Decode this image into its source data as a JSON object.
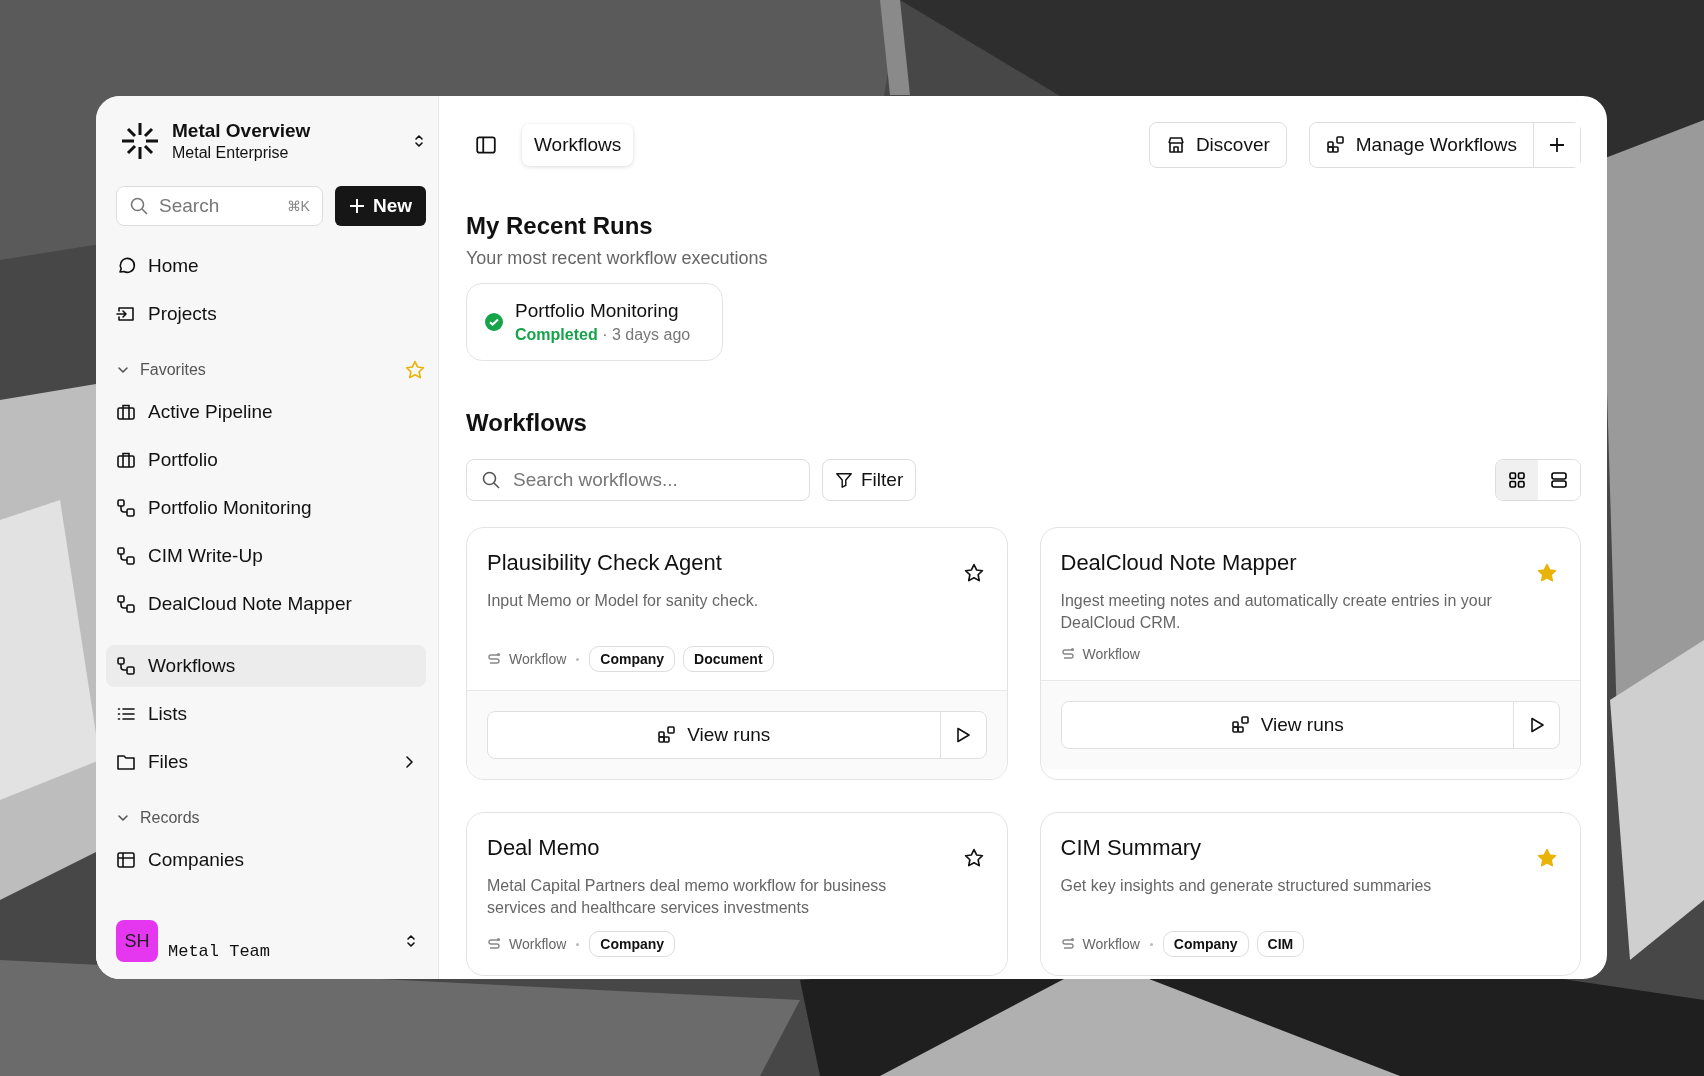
{
  "sidebar": {
    "workspace": {
      "name": "Metal Overview",
      "subtitle": "Metal Enterprise"
    },
    "search": {
      "placeholder": "Search",
      "shortcut": "⌘K"
    },
    "new_button": "New",
    "primary": [
      {
        "label": "Home",
        "kind": "chat",
        "selected": false
      },
      {
        "label": "Projects",
        "kind": "import",
        "selected": false
      }
    ],
    "favorites": {
      "label": "Favorites",
      "expanded": true,
      "items": [
        {
          "label": "Active Pipeline",
          "kind": "briefcase",
          "selected": false
        },
        {
          "label": "Portfolio",
          "kind": "briefcase",
          "selected": false
        },
        {
          "label": "Portfolio Monitoring",
          "kind": "flow",
          "selected": false
        },
        {
          "label": "CIM Write-Up",
          "kind": "flow",
          "selected": false
        },
        {
          "label": "DealCloud Note Mapper",
          "kind": "flow",
          "selected": false
        }
      ]
    },
    "secondary": [
      {
        "label": "Workflows",
        "kind": "flow",
        "selected": true,
        "expandable": false
      },
      {
        "label": "Lists",
        "kind": "list",
        "selected": false,
        "expandable": false
      },
      {
        "label": "Files",
        "kind": "folder",
        "selected": false,
        "expandable": true
      }
    ],
    "records": {
      "label": "Records",
      "expanded": true,
      "items": [
        {
          "label": "Companies",
          "kind": "table",
          "selected": false
        }
      ]
    },
    "user": {
      "initials": "SH",
      "team": "Metal Team"
    }
  },
  "main": {
    "breadcrumb": "Workflows",
    "actions": [
      {
        "label": "Discover",
        "kind": "store"
      },
      {
        "label": "Manage Workflows",
        "kind": "manage"
      }
    ],
    "recent_runs": {
      "title": "My Recent Runs",
      "subtitle": "Your most recent workflow executions",
      "runs": [
        {
          "name": "Portfolio Monitoring",
          "status": "Completed",
          "time": "· 3 days ago"
        }
      ]
    },
    "workflows": {
      "title": "Workflows",
      "search_placeholder": "Search workflows...",
      "filter": "Filter",
      "views": [
        {
          "kind": "grid",
          "selected": true
        },
        {
          "kind": "list",
          "selected": false
        }
      ],
      "cards": [
        {
          "title": "Plausibility Check Agent",
          "description": "Input Memo or Model for sanity check.",
          "type": "Workflow",
          "tags": [
            "Company",
            "Document"
          ],
          "favorite": false,
          "action": "View runs"
        },
        {
          "title": "DealCloud Note Mapper",
          "description": "Ingest meeting notes and automatically create entries in your DealCloud CRM.",
          "type": "Workflow",
          "favorite": true,
          "action": "View runs"
        },
        {
          "title": "Deal Memo",
          "description": "Metal Capital Partners deal memo workflow for business services and healthcare services investments",
          "type": "Workflow",
          "tags": [
            "Company"
          ],
          "favorite": false
        },
        {
          "title": "CIM Summary",
          "description": "Get key insights and generate structured summaries",
          "type": "Workflow",
          "tags": [
            "Company",
            "CIM"
          ],
          "favorite": true
        }
      ]
    }
  }
}
